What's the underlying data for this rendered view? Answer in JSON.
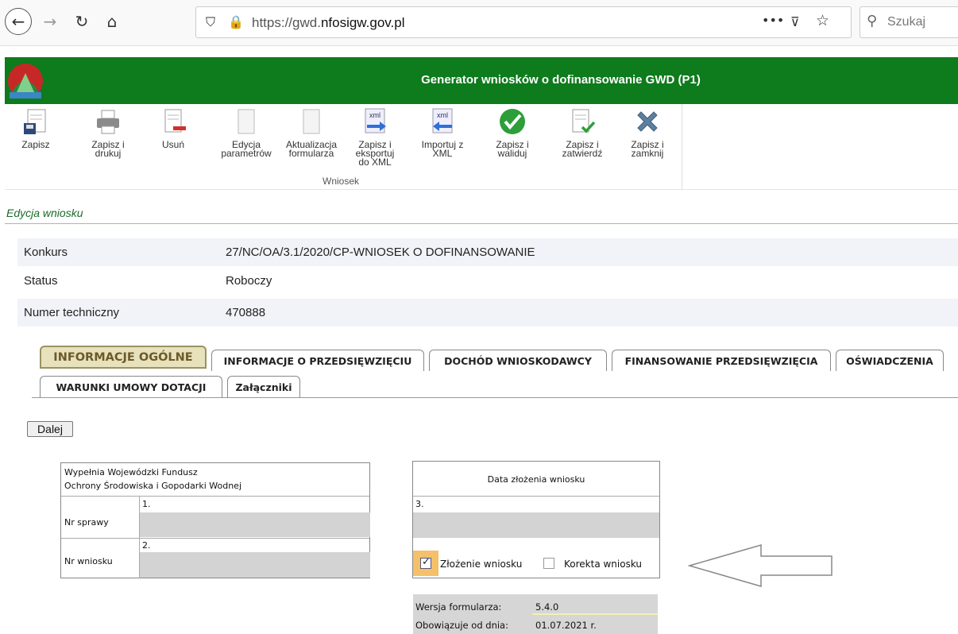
{
  "browser": {
    "url_prefix": "https://gwd.",
    "url_domain": "nfosigw.gov.pl",
    "search_placeholder": "Szukaj",
    "more_icon": "•••"
  },
  "header": {
    "title": "Generator wniosków o dofinansowanie GWD (P1)"
  },
  "toolbar": {
    "buttons": [
      {
        "label": "Zapisz",
        "icon": "save-icon"
      },
      {
        "label": "Zapisz i\ndrukuj",
        "icon": "print-icon"
      },
      {
        "label": "Usuń",
        "icon": "delete-icon"
      },
      {
        "label": "Edycja\nparametrów",
        "icon": "blank-doc-icon"
      },
      {
        "label": "Aktualizacja\nformularza",
        "icon": "blank-doc-icon"
      },
      {
        "label": "Zapisz i\neksportuj\ndo XML",
        "icon": "xml-export-icon"
      },
      {
        "label": "Importuj z\nXML",
        "icon": "xml-import-icon"
      },
      {
        "label": "Zapisz i\nwaliduj",
        "icon": "check-icon"
      },
      {
        "label": "Zapisz i\nzatwierdź",
        "icon": "approve-icon"
      },
      {
        "label": "Zapisz i\nzamknij",
        "icon": "close-icon"
      }
    ],
    "xml_badge": "xml",
    "group_label": "Wniosek"
  },
  "section_title": "Edycja wniosku",
  "info": [
    {
      "key": "Konkurs",
      "value": "27/NC/OA/3.1/2020/CP-WNIOSEK O DOFINANSOWANIE"
    },
    {
      "key": "Status",
      "value": "Roboczy"
    },
    {
      "key": "Numer techniczny",
      "value": "470888"
    }
  ],
  "tabs_row1": [
    "INFORMACJE OGÓLNE",
    "INFORMACJE O PRZEDSIĘWZIĘCIU",
    "DOCHÓD WNIOSKODAWCY",
    "FINANSOWANIE PRZEDSIĘWZIĘCIA",
    "OŚWIADCZENIA"
  ],
  "tabs_row2": [
    "WARUNKI UMOWY DOTACJI",
    "Załączniki"
  ],
  "active_tab": "INFORMACJE OGÓLNE",
  "dalej_label": "Dalej",
  "form_left": {
    "header_line1": "Wypełnia Wojewódzki Fundusz",
    "header_line2": "Ochrony Środowiska i Gopodarki Wodnej",
    "field1_num": "1.",
    "field1_label": "Nr sprawy",
    "field2_num": "2.",
    "field2_label": "Nr wniosku"
  },
  "form_right": {
    "header": "Data złożenia wniosku",
    "field3_num": "3.",
    "check1_label": "Złożenie wniosku",
    "check1_checked": true,
    "check2_label": "Korekta wniosku",
    "check2_checked": false
  },
  "version": {
    "label1": "Wersja formularza:",
    "value1": "5.4.0",
    "label2": "Obowiązuje od dnia:",
    "value2": "01.07.2021 r."
  },
  "colors": {
    "header_green": "#0e7b1c",
    "active_tab_bg": "#e7e1bc",
    "highlight_orange": "#f5c06a"
  }
}
